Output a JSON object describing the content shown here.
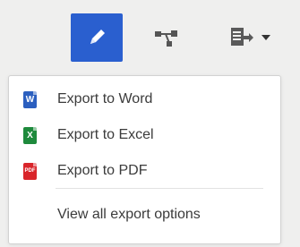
{
  "colors": {
    "edit_button_bg": "#2a5fcf",
    "word": "#2b5fbf",
    "excel": "#1e8a3c",
    "pdf": "#d9252a"
  },
  "toolbar": {
    "edit_icon": "pencil-icon",
    "connect_icon": "network-nodes-icon",
    "export_icon": "export-document-icon",
    "dropdown_icon": "caret-down-icon"
  },
  "menu": {
    "items": [
      {
        "label": "Export to Word",
        "icon": "word-file-icon",
        "glyph": "W"
      },
      {
        "label": "Export to Excel",
        "icon": "excel-file-icon",
        "glyph": "X"
      },
      {
        "label": "Export to PDF",
        "icon": "pdf-file-icon",
        "glyph": "PDF"
      }
    ],
    "view_all_label": "View all export options"
  }
}
